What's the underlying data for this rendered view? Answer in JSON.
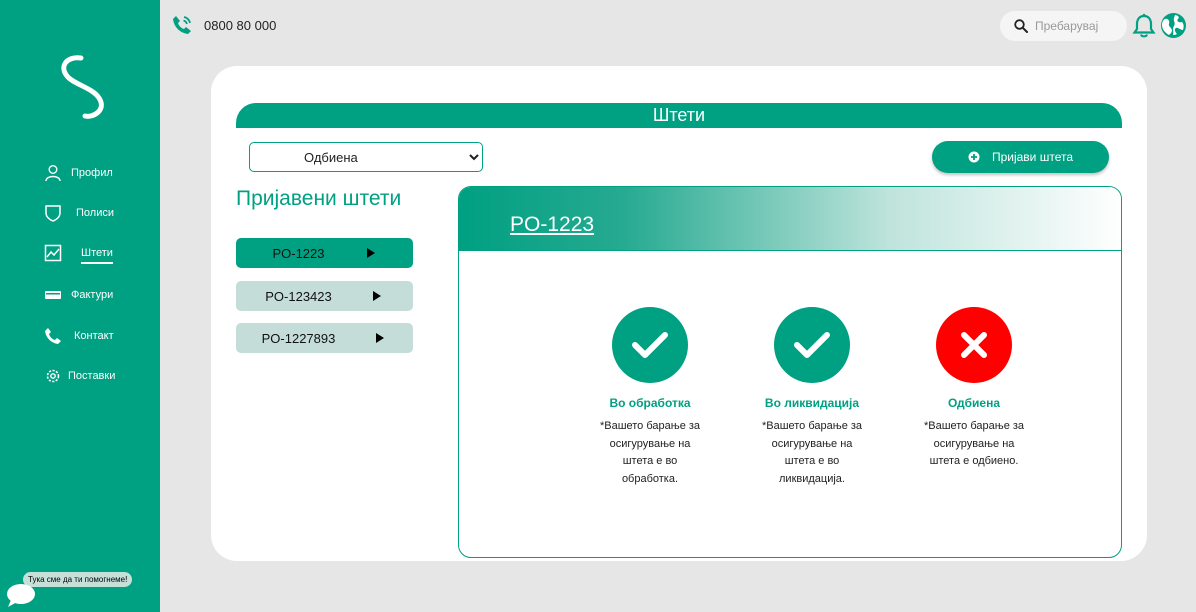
{
  "sidebar": {
    "items": [
      {
        "label": "Профил",
        "icon": "user-icon"
      },
      {
        "label": "Полиси",
        "icon": "shield-icon"
      },
      {
        "label": "Штети",
        "icon": "chart-icon",
        "active": true
      },
      {
        "label": "Фактури",
        "icon": "card-icon"
      },
      {
        "label": "Контакт",
        "icon": "phone-icon"
      },
      {
        "label": "Поставки",
        "icon": "gear-icon"
      }
    ],
    "help_text": "Тука сме да ти помогнеме!"
  },
  "topbar": {
    "phone": "0800 80 000",
    "search_placeholder": "Пребарувај"
  },
  "main": {
    "banner_title": "Штети",
    "filter": {
      "selected": "Одбиена"
    },
    "report_button": "Пријави штета",
    "list_title": "Пријавени штети",
    "claims": [
      {
        "id": "PO-1223",
        "active": true
      },
      {
        "id": "PO-123423",
        "active": false
      },
      {
        "id": "PO-1227893",
        "active": false
      }
    ],
    "detail": {
      "claim_id": "PO-1223",
      "statuses": [
        {
          "title": "Во обработка",
          "description": "*Вашето барање за осигурување на штета е во обработка.",
          "state": "success"
        },
        {
          "title": "Во ликвидација",
          "description": "*Вашето барање за осигурување на штета е во ликвидација.",
          "state": "success"
        },
        {
          "title": "Одбиена",
          "description": "*Вашето барање за осигурување на штета е одбиено.",
          "state": "rejected"
        }
      ]
    }
  },
  "colors": {
    "brand": "#00a082",
    "light_item": "#c5ddd8",
    "rejected": "#ff0000",
    "background": "#e6e6e6"
  }
}
